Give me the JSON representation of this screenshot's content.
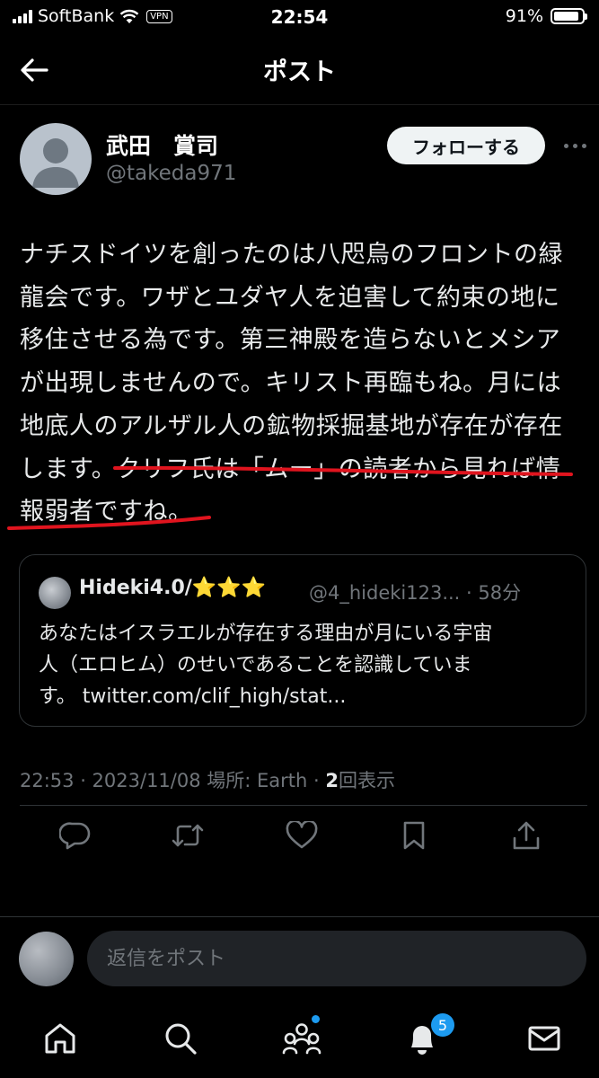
{
  "status_bar": {
    "carrier": "SoftBank",
    "vpn": "VPN",
    "time": "22:54",
    "battery": "91%",
    "battery_level": 0.91
  },
  "header": {
    "title": "ポスト"
  },
  "author": {
    "name": "武田　賞司",
    "handle": "@takeda971"
  },
  "follow_button": "フォローする",
  "tweet": {
    "lines": [
      "ナチスドイツを創ったのは八咫烏のフロントの緑",
      "龍会です。ワザとユダヤ人を迫害して約束の地に",
      "移住させる為です。第三神殿を造らないとメシア",
      "が出現しませんので。キリスト再臨もね。月には",
      "地底人のアルザル人の鉱物採掘基地が存在が存在",
      "します。クリフ氏は「ムー」の読者から見れば情",
      "報弱者ですね。"
    ]
  },
  "quote": {
    "name": "Hideki4.0/⭐⭐⭐",
    "handle": "@4_hideki123... · 58分",
    "lines": [
      "あなたはイスラエルが存在する理由が月にいる宇宙",
      "人（エロヒム）のせいであることを認識していま",
      "す。 twitter.com/clif_high/stat..."
    ]
  },
  "meta": {
    "timestamp": "22:53 · 2023/11/08 場所: Earth · ",
    "view_count": "2",
    "view_label": "回表示"
  },
  "actions": [
    "reply-icon",
    "retweet-icon",
    "like-icon",
    "bookmark-icon",
    "share-icon"
  ],
  "reply": {
    "placeholder": "返信をポスト"
  },
  "tab_bar": {
    "items": [
      "home-icon",
      "search-icon",
      "communities-icon",
      "notifications-icon",
      "messages-icon"
    ],
    "notification_badge": "5",
    "colors": {
      "accent": "#1d9bf0",
      "underline": "#e0141e"
    }
  }
}
